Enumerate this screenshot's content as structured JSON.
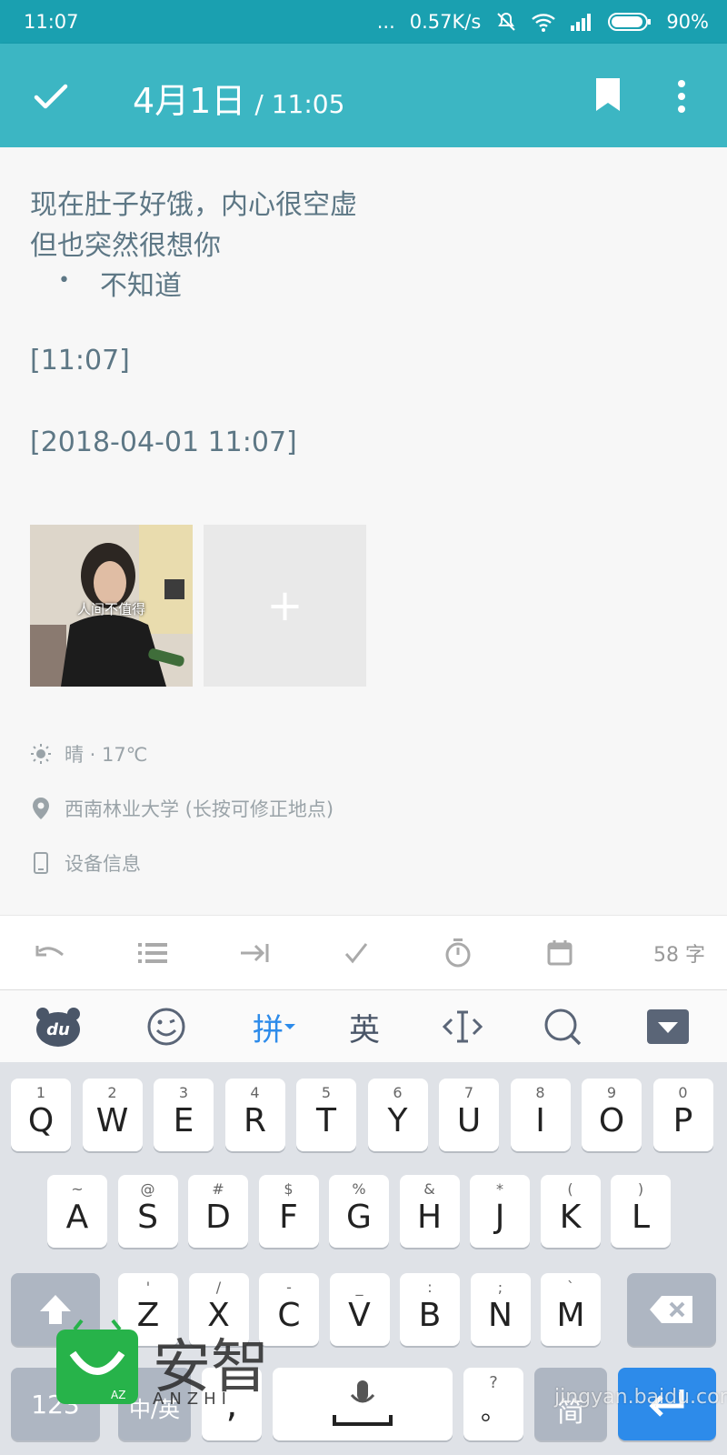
{
  "status_bar": {
    "time": "11:07",
    "more": "...",
    "network_speed": "0.57K/s",
    "battery": "90%"
  },
  "app_bar": {
    "date": "4月1日",
    "time": "/ 11:05"
  },
  "note": {
    "lines": [
      "现在肚子好饿，内心很空虚",
      "但也突然很想你"
    ],
    "bullet_item": "不知道",
    "timestamp_short": "[11:07]",
    "timestamp_full": "[2018-04-01 11:07]",
    "photo_caption": "人间不值得",
    "add_photo": "+"
  },
  "meta": {
    "weather": "晴 · 17℃",
    "location": "西南林业大学 (长按可修正地点)",
    "device": "设备信息"
  },
  "toolbar": {
    "word_count": "58 字"
  },
  "ime": {
    "pinyin": "拼",
    "english": "英"
  },
  "keyboard": {
    "row1": [
      {
        "sub": "1",
        "main": "Q"
      },
      {
        "sub": "2",
        "main": "W"
      },
      {
        "sub": "3",
        "main": "E"
      },
      {
        "sub": "4",
        "main": "R"
      },
      {
        "sub": "5",
        "main": "T"
      },
      {
        "sub": "6",
        "main": "Y"
      },
      {
        "sub": "7",
        "main": "U"
      },
      {
        "sub": "8",
        "main": "I"
      },
      {
        "sub": "9",
        "main": "O"
      },
      {
        "sub": "0",
        "main": "P"
      }
    ],
    "row2": [
      {
        "sub": "~",
        "main": "A"
      },
      {
        "sub": "@",
        "main": "S"
      },
      {
        "sub": "#",
        "main": "D"
      },
      {
        "sub": "$",
        "main": "F"
      },
      {
        "sub": "%",
        "main": "G"
      },
      {
        "sub": "&",
        "main": "H"
      },
      {
        "sub": "*",
        "main": "J"
      },
      {
        "sub": "(",
        "main": "K"
      },
      {
        "sub": ")",
        "main": "L"
      }
    ],
    "row3": [
      {
        "sub": "'",
        "main": "Z"
      },
      {
        "sub": "/",
        "main": "X"
      },
      {
        "sub": "-",
        "main": "C"
      },
      {
        "sub": "_",
        "main": "V"
      },
      {
        "sub": ":",
        "main": "B"
      },
      {
        "sub": ";",
        "main": "N"
      },
      {
        "sub": "`",
        "main": "M"
      }
    ],
    "bottom": {
      "num_key": "123",
      "lang_key": "中/英",
      "comma_key": ",",
      "punct_sub": "?",
      "punct_main": "。",
      "jian_key": "简"
    }
  },
  "watermarks": {
    "anzhi_cn": "安智",
    "anzhi_en": "ANZHI",
    "baidu": "jingyan.baidu.com"
  },
  "colors": {
    "status_bar": "#1aa0b0",
    "app_bar": "#3cb6c3",
    "note_text": "#5d7785",
    "ime_accent": "#2d8bea"
  }
}
